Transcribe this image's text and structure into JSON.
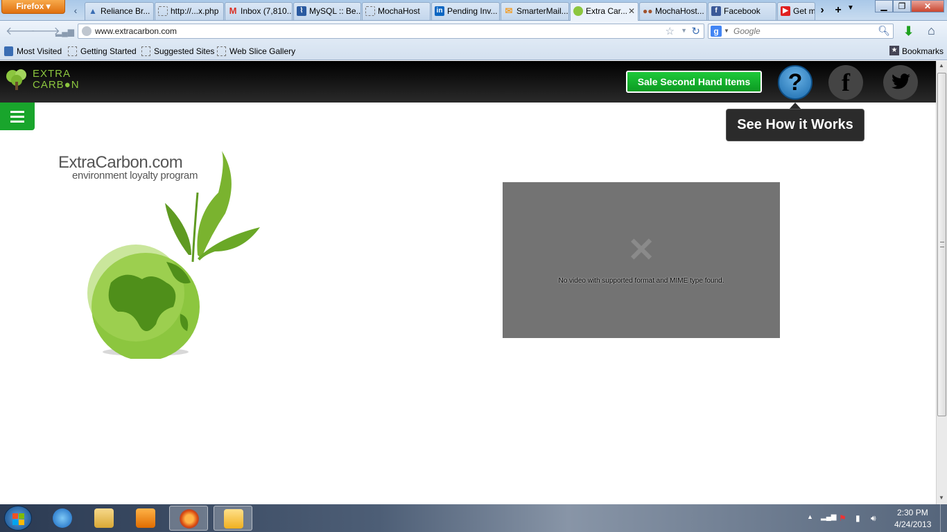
{
  "browser": {
    "menu_label": "Firefox",
    "tabs": [
      {
        "label": "Reliance Br...",
        "icon": "reliance-icon",
        "color": "#3a6db3"
      },
      {
        "label": "http://...x.php",
        "icon": "blank-page-icon",
        "color": "#ffffff"
      },
      {
        "label": "Inbox (7,810...",
        "icon": "gmail-icon",
        "color": "#d93025"
      },
      {
        "label": "MySQL :: Be...",
        "icon": "mysql-icon",
        "color": "#2a5aa0"
      },
      {
        "label": "MochaHost",
        "icon": "blank-page-icon",
        "color": "#ffffff"
      },
      {
        "label": "Pending Inv...",
        "icon": "linkedin-icon",
        "color": "#0a66c2"
      },
      {
        "label": "SmarterMail...",
        "icon": "mail-icon",
        "color": "#f0a030"
      },
      {
        "label": "Extra Car...",
        "icon": "tree-icon",
        "color": "#8cc63f",
        "active": true
      },
      {
        "label": "MochaHost...",
        "icon": "mochahost-icon",
        "color": "#a0522d"
      },
      {
        "label": "Facebook",
        "icon": "facebook-icon",
        "color": "#3b5998"
      },
      {
        "label": "Get m",
        "icon": "youtube-icon",
        "color": "#e02020"
      }
    ],
    "url": "www.extracarbon.com",
    "search_placeholder": "Google",
    "bookmarks": [
      "Most Visited",
      "Getting Started",
      "Suggested Sites",
      "Web Slice Gallery"
    ],
    "bookmarks_menu": "Bookmarks"
  },
  "site": {
    "logo_line1": "EXTRA",
    "logo_line2": "CARB●N",
    "sale_button": "Sale Second Hand Items",
    "help_symbol": "?",
    "facebook_symbol": "f",
    "tooltip": "See How it Works",
    "brand_title": "ExtraCarbon.com",
    "brand_subtitle": "environment loyalty program",
    "video_error": "No video with supported format and MIME type found.",
    "colors": {
      "accent_green": "#19a52c",
      "logo_green": "#8cc63f",
      "help_blue": "#1a6bae"
    }
  },
  "taskbar": {
    "time": "2:30 PM",
    "date": "4/24/2013"
  }
}
